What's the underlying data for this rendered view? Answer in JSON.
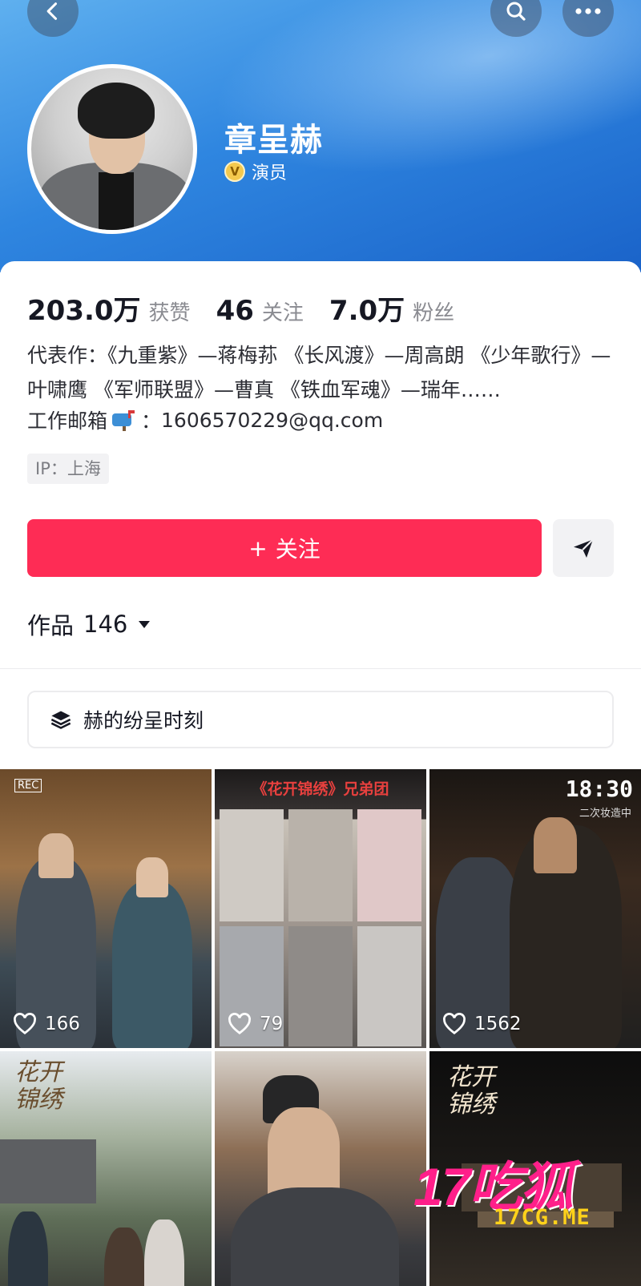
{
  "header": {
    "name": "章呈赫",
    "verify_badge": "V",
    "verify_text": "演员"
  },
  "stats": [
    {
      "value": "203.0万",
      "label": "获赞"
    },
    {
      "value": "46",
      "label": "关注"
    },
    {
      "value": "7.0万",
      "label": "粉丝"
    }
  ],
  "bio": {
    "text": "代表作：《九重紫》—蒋梅荪 《长风渡》—周高朗 《少年歌行》—叶啸鹰 《军师联盟》—曹真 《铁血军魂》—瑞年……",
    "email_label": "工作邮箱",
    "email_sep": "：",
    "email": "1606570229@qq.com",
    "ip": "IP：上海"
  },
  "actions": {
    "follow_plus": "+",
    "follow_label": "关注"
  },
  "works": {
    "label": "作品",
    "count": "146"
  },
  "collection": {
    "label": "赫的纷呈时刻"
  },
  "videos": [
    {
      "likes": "166"
    },
    {
      "likes": "79",
      "title": "《花开锦绣》兄弟团"
    },
    {
      "likes": "1562",
      "time": "18:30",
      "time_sub": "二次妆造中"
    },
    {
      "calligraphy": "花开锦绣"
    },
    {},
    {
      "calligraphy": "花开锦绣"
    }
  ],
  "watermark": {
    "big": "17吃狐",
    "small": "17CG.ME"
  },
  "colors": {
    "accent": "#fe2c55",
    "banner": "#2f86e0"
  }
}
